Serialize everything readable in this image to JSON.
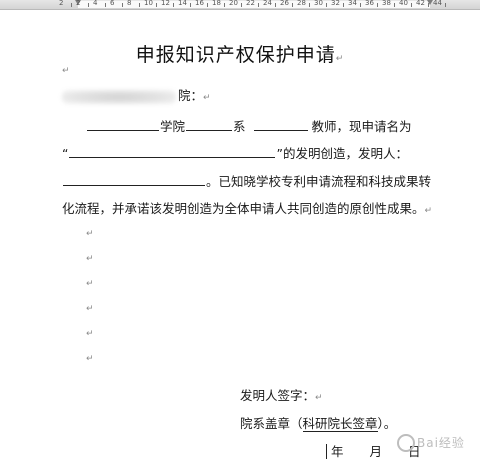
{
  "ruler": {
    "numbers": [
      "2",
      "2",
      "4",
      "6",
      "8",
      "10",
      "12",
      "14",
      "16",
      "18",
      "20",
      "22",
      "24",
      "26",
      "28",
      "30",
      "32",
      "34",
      "36",
      "38",
      "40",
      "42",
      "44"
    ]
  },
  "document": {
    "title": "申报知识产权保护申请",
    "paragraph_mark": "↵",
    "salutation_suffix": "院：",
    "body": {
      "line1_college": "学院",
      "line1_dept": "系",
      "line1_rest": "教师，现申请名为",
      "line2_quote_open": "“",
      "line2_rest": "”的发明创造，发明人：",
      "line3_rest": "。已知晓学校专利申请流程和科技成果转",
      "line4": "化流程，并承诺该发明创造为全体申请人共同创造的原创性成果。"
    },
    "signature": {
      "inventor_label": "发明人签字：",
      "dept_seal_prefix": "院系盖章（",
      "dept_seal_underlined": "科研院长签章",
      "dept_seal_suffix": "）。",
      "year": "年",
      "month": "月",
      "day": "日"
    }
  },
  "watermark": {
    "text": "Bai经验"
  }
}
